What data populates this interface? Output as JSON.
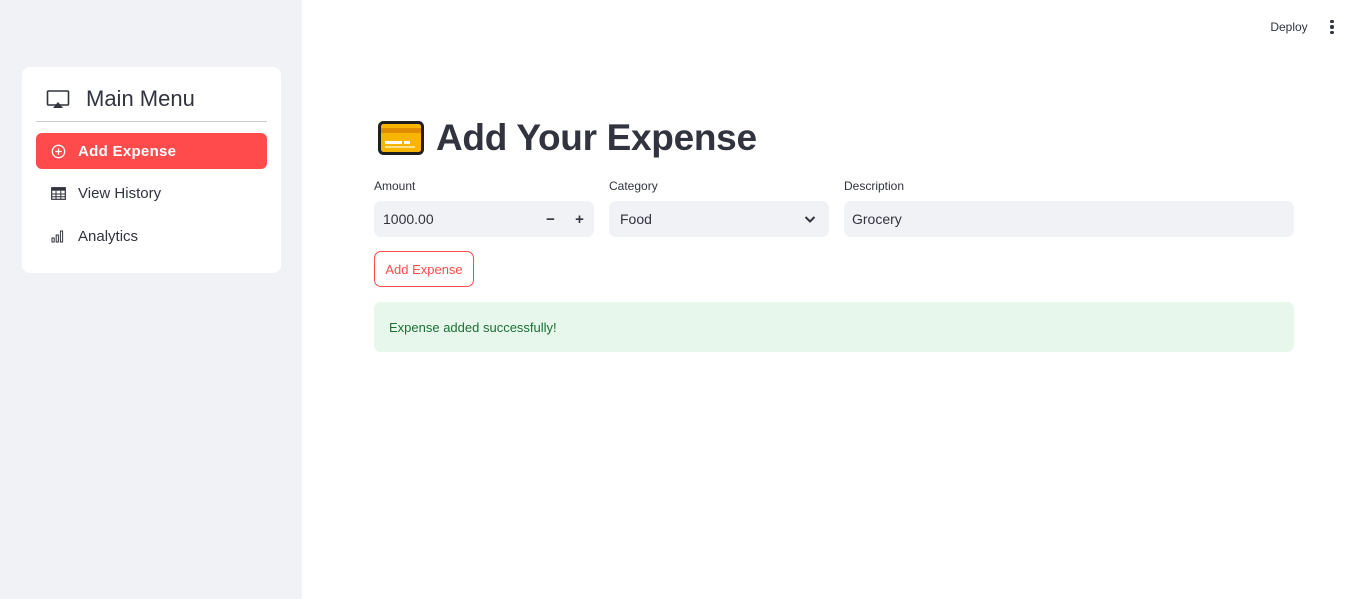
{
  "header": {
    "deploy_label": "Deploy",
    "menu_icon": "kebab-menu-icon"
  },
  "sidebar": {
    "menu_title": "Main Menu",
    "menu_icon": "cast-icon",
    "items": [
      {
        "label": "Add Expense",
        "icon": "plus-circle-icon",
        "active": true
      },
      {
        "label": "View History",
        "icon": "table-icon",
        "active": false
      },
      {
        "label": "Analytics",
        "icon": "bar-chart-icon",
        "active": false
      }
    ]
  },
  "main": {
    "title": "Add Your Expense",
    "title_icon": "credit-card-icon",
    "amount": {
      "label": "Amount",
      "value": "1000.00",
      "decrement": "−",
      "increment": "+"
    },
    "category": {
      "label": "Category",
      "value": "Food"
    },
    "description": {
      "label": "Description",
      "value": "Grocery"
    },
    "submit_label": "Add Expense",
    "success_message": "Expense added successfully!"
  },
  "colors": {
    "accent": "#ff4b4b",
    "sidebar_bg": "#f0f2f6",
    "success_bg": "#e7f7ec",
    "success_text": "#1c7036",
    "text": "#31333f"
  }
}
